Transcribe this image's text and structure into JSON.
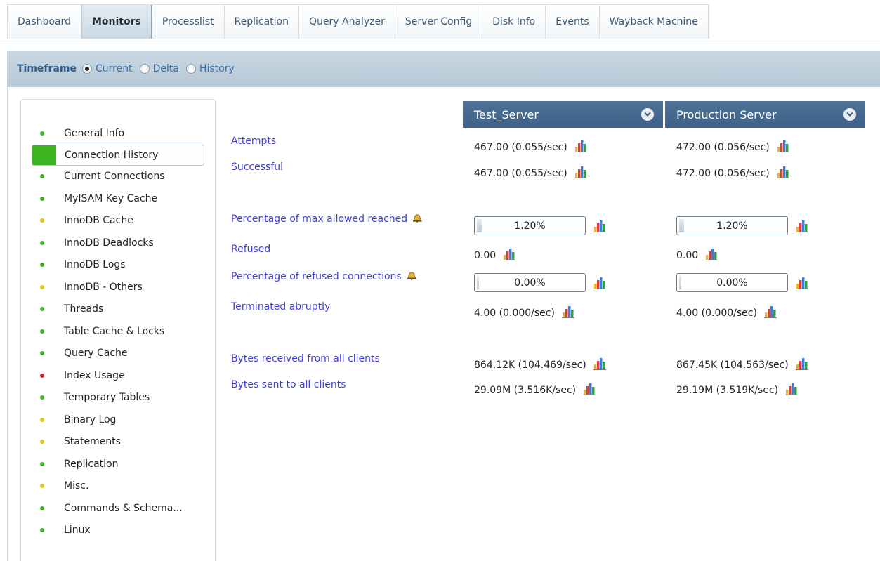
{
  "nav": {
    "tabs": [
      {
        "label": "Dashboard"
      },
      {
        "label": "Monitors"
      },
      {
        "label": "Processlist"
      },
      {
        "label": "Replication"
      },
      {
        "label": "Query Analyzer"
      },
      {
        "label": "Server Config"
      },
      {
        "label": "Disk Info"
      },
      {
        "label": "Events"
      },
      {
        "label": "Wayback Machine"
      }
    ],
    "active": "Monitors"
  },
  "timeframe": {
    "title": "Timeframe",
    "options": [
      "Current",
      "Delta",
      "History"
    ],
    "selected": "Current"
  },
  "sidebar": {
    "items": [
      {
        "label": "General Info",
        "status": "#3cb521"
      },
      {
        "label": "Connection History",
        "status": "#3cb521",
        "active": true
      },
      {
        "label": "Current Connections",
        "status": "#3cb521"
      },
      {
        "label": "MyISAM Key Cache",
        "status": "#3cb521"
      },
      {
        "label": "InnoDB Cache",
        "status": "#e8c41a"
      },
      {
        "label": "InnoDB Deadlocks",
        "status": "#3cb521"
      },
      {
        "label": "InnoDB Logs",
        "status": "#3cb521"
      },
      {
        "label": "InnoDB - Others",
        "status": "#e8c41a"
      },
      {
        "label": "Threads",
        "status": "#3cb521"
      },
      {
        "label": "Table Cache & Locks",
        "status": "#3cb521"
      },
      {
        "label": "Query Cache",
        "status": "#3cb521"
      },
      {
        "label": "Index Usage",
        "status": "#e02020"
      },
      {
        "label": "Temporary Tables",
        "status": "#3cb521"
      },
      {
        "label": "Binary Log",
        "status": "#e8c41a"
      },
      {
        "label": "Statements",
        "status": "#e8c41a"
      },
      {
        "label": "Replication",
        "status": "#3cb521"
      },
      {
        "label": "Misc.",
        "status": "#e8c41a"
      },
      {
        "label": "Commands & Schema...",
        "status": "#3cb521"
      },
      {
        "label": "Linux",
        "status": "#3cb521"
      }
    ]
  },
  "servers": [
    {
      "name": "Test_Server",
      "attempts": "467.00 (0.055/sec)",
      "successful": "467.00 (0.055/sec)",
      "pct_max_allowed": "1.20%",
      "pct_max_allowed_value": 0.012,
      "refused": "0.00",
      "pct_refused": "0.00%",
      "pct_refused_value": 0.0,
      "terminated": "4.00 (0.000/sec)",
      "bytes_received": "864.12K (104.469/sec)",
      "bytes_sent": "29.09M (3.516K/sec)"
    },
    {
      "name": "Production Server",
      "attempts": "472.00 (0.056/sec)",
      "successful": "472.00 (0.056/sec)",
      "pct_max_allowed": "1.20%",
      "pct_max_allowed_value": 0.012,
      "refused": "0.00",
      "pct_refused": "0.00%",
      "pct_refused_value": 0.0,
      "terminated": "4.00 (0.000/sec)",
      "bytes_received": "867.45K (104.563/sec)",
      "bytes_sent": "29.19M (3.519K/sec)"
    }
  ],
  "metrics": {
    "attempts": "Attempts",
    "successful": "Successful",
    "pct_max_allowed": "Percentage of max allowed reached",
    "refused": "Refused",
    "pct_refused": "Percentage of refused connections",
    "terminated": "Terminated abruptly",
    "bytes_received": "Bytes received from all clients",
    "bytes_sent": "Bytes sent to all clients"
  },
  "icons": {
    "chart": "bar-chart-icon",
    "alert": "bell-icon",
    "dropdown": "chevron-down-icon"
  },
  "colors": {
    "status_ok": "#3cb521",
    "status_warn": "#e8c41a",
    "status_crit": "#e02020",
    "link": "#4040d8",
    "header": "#4a6d91"
  }
}
